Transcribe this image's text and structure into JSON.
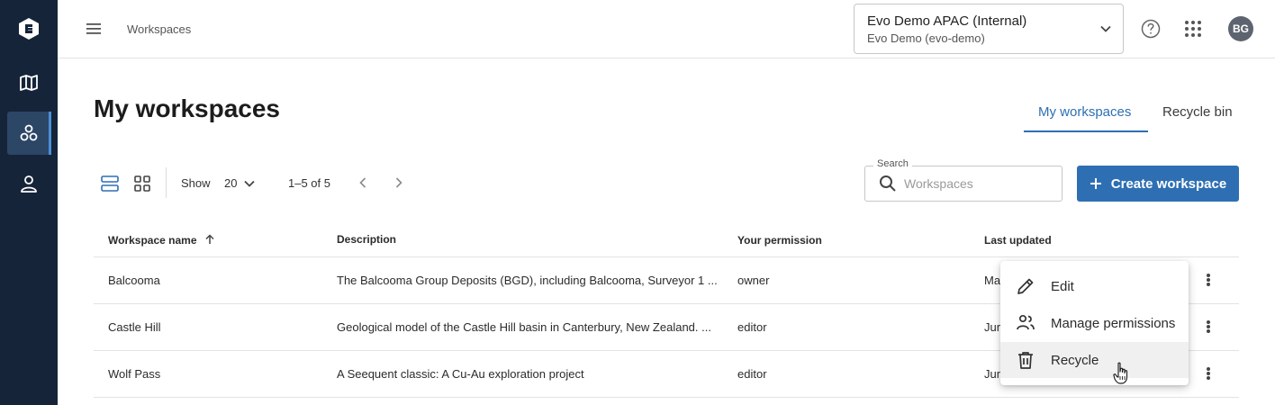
{
  "app": {
    "logo_icon": "evo-logo-icon",
    "rail": [
      {
        "icon": "map-icon",
        "active": false
      },
      {
        "icon": "workspaces-icon",
        "active": true
      },
      {
        "icon": "user-icon",
        "active": false
      }
    ]
  },
  "header": {
    "breadcrumb": "Workspaces",
    "org_title": "Evo Demo APAC (Internal)",
    "org_sub": "Evo Demo (evo-demo)",
    "avatar": "BG"
  },
  "page": {
    "title": "My workspaces",
    "tabs": [
      "My workspaces",
      "Recycle bin"
    ]
  },
  "toolbar": {
    "show_label": "Show",
    "page_size": "20",
    "range": "1–5 of 5",
    "search_label": "Search",
    "search_placeholder": "Workspaces",
    "create_label": "Create workspace"
  },
  "table": {
    "columns": [
      "Workspace name",
      "Description",
      "Your permission",
      "Last updated"
    ],
    "rows": [
      {
        "name": "Balcooma",
        "description": "The Balcooma Group Deposits (BGD), including Balcooma, Surveyor 1 ...",
        "permission": "owner",
        "updated": "Ma"
      },
      {
        "name": "Castle Hill",
        "description": "Geological model of the Castle Hill basin in Canterbury, New Zealand. ...",
        "permission": "editor",
        "updated": "Jur"
      },
      {
        "name": "Wolf Pass",
        "description": "A Seequent classic: A Cu-Au exploration project",
        "permission": "editor",
        "updated": "Jur"
      }
    ]
  },
  "context_menu": {
    "items": [
      "Edit",
      "Manage permissions",
      "Recycle"
    ],
    "hovered": "Recycle"
  },
  "colors": {
    "rail_bg": "#16243a",
    "accent": "#2e6fb3"
  }
}
